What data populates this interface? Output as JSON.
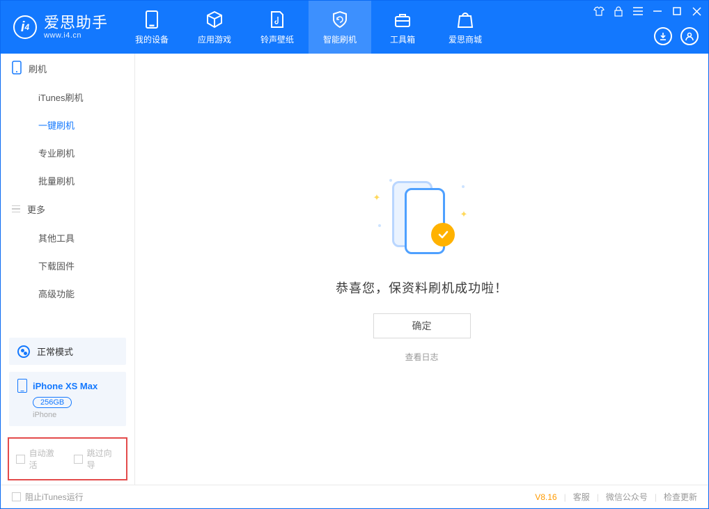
{
  "app": {
    "title": "爱思助手",
    "subtitle": "www.i4.cn"
  },
  "nav": {
    "my_device": "我的设备",
    "apps_games": "应用游戏",
    "ringtones": "铃声壁纸",
    "flash": "智能刷机",
    "toolbox": "工具箱",
    "store": "爱思商城"
  },
  "sidebar": {
    "section_flash": "刷机",
    "items_flash": {
      "itunes": "iTunes刷机",
      "one_click": "一键刷机",
      "pro": "专业刷机",
      "batch": "批量刷机"
    },
    "section_more": "更多",
    "items_more": {
      "other_tools": "其他工具",
      "download_fw": "下载固件",
      "advanced": "高级功能"
    }
  },
  "mode": {
    "label": "正常模式"
  },
  "device": {
    "name": "iPhone XS Max",
    "storage": "256GB",
    "type": "iPhone"
  },
  "checkboxes": {
    "auto_activate": "自动激活",
    "skip_guide": "跳过向导"
  },
  "main": {
    "success": "恭喜您，保资料刷机成功啦！",
    "ok": "确定",
    "view_log": "查看日志"
  },
  "status": {
    "block_itunes": "阻止iTunes运行",
    "version": "V8.16",
    "support": "客服",
    "wechat": "微信公众号",
    "check_update": "检查更新"
  }
}
